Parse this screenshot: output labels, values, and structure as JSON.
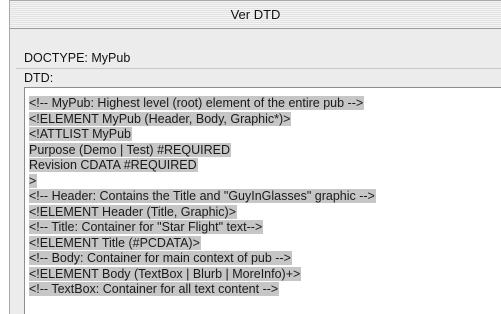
{
  "window": {
    "title": "Ver DTD"
  },
  "doctype": {
    "text": "DOCTYPE: MyPub"
  },
  "dtd": {
    "label": "DTD:",
    "lines": [
      "<!-- MyPub: Highest level (root) element of the entire pub -->",
      "<!ELEMENT MyPub (Header, Body, Graphic*)>",
      "<!ATTLIST MyPub",
      "Purpose (Demo | Test) #REQUIRED",
      "Revision CDATA #REQUIRED",
      ">",
      "<!-- Header: Contains the Title and \"GuyInGlasses\" graphic -->",
      "<!ELEMENT Header (Title, Graphic)>",
      "<!-- Title: Container for \"Star Flight\" text-->",
      "<!ELEMENT Title (#PCDATA)>",
      "<!-- Body: Container for main context of pub -->",
      "<!ELEMENT Body (TextBox | Blurb | MoreInfo)+>",
      "<!-- TextBox: Container for all text content -->"
    ]
  }
}
